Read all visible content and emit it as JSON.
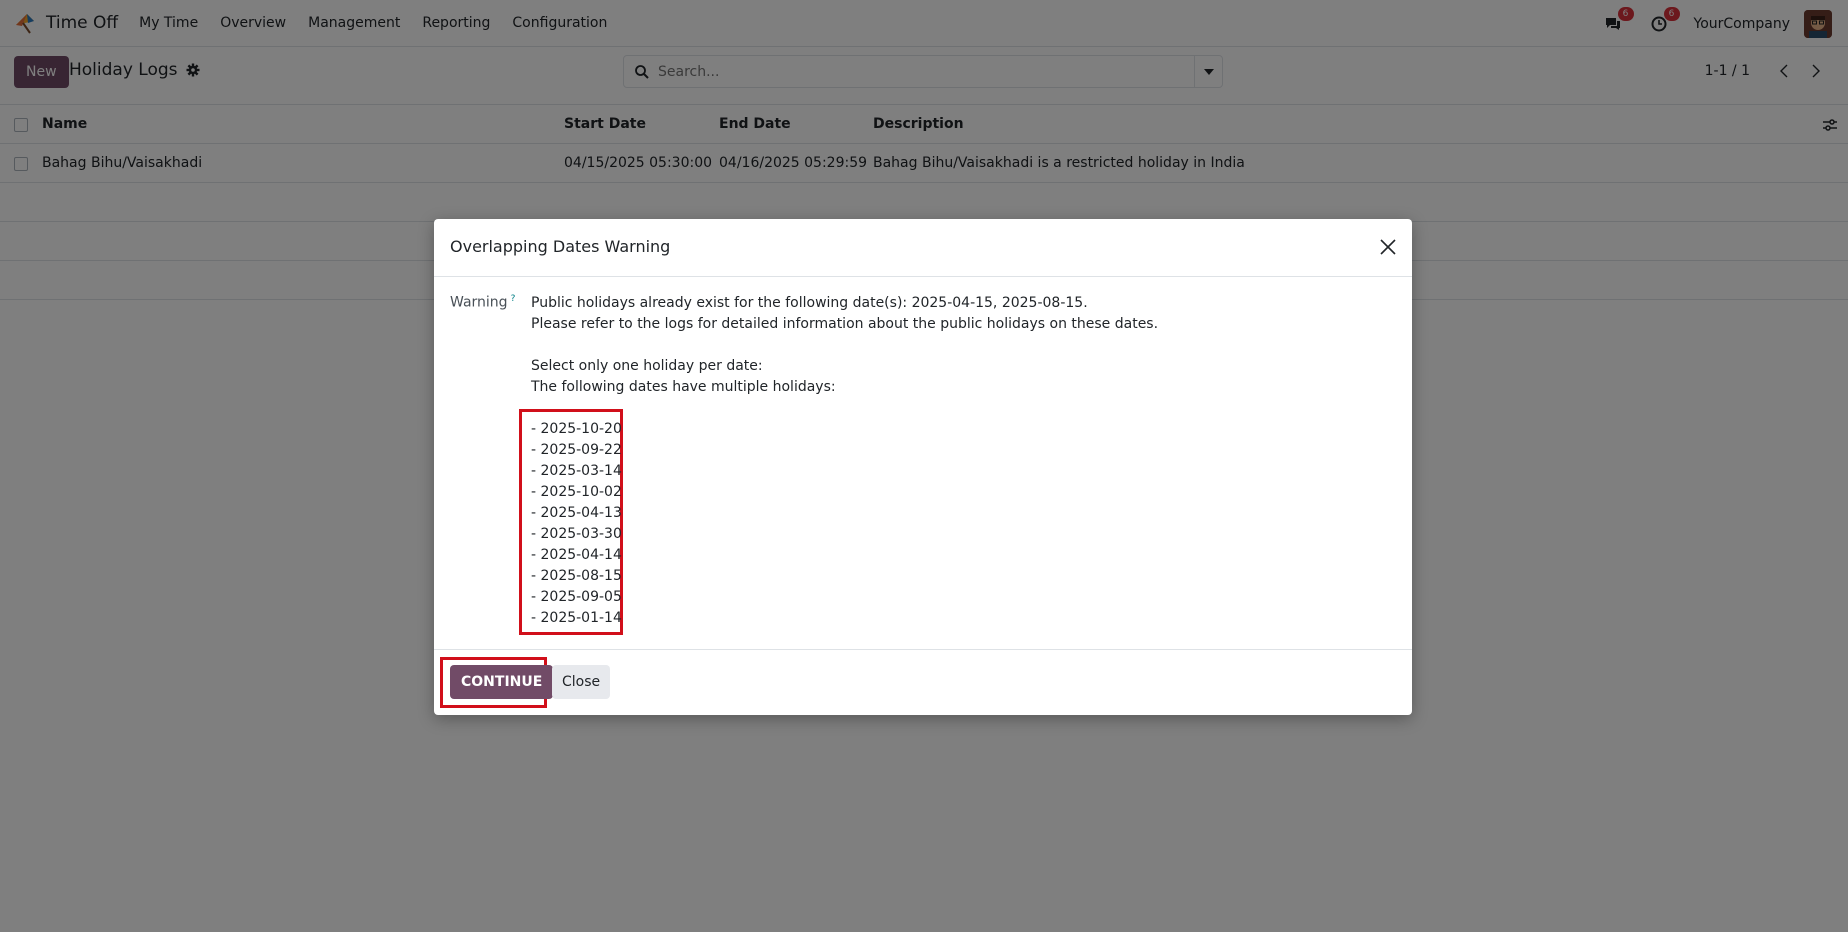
{
  "navbar": {
    "app_name": "Time Off",
    "menu": [
      "My Time",
      "Overview",
      "Management",
      "Reporting",
      "Configuration"
    ],
    "messages_badge": "6",
    "activities_badge": "6",
    "company": "YourCompany"
  },
  "control_panel": {
    "new_label": "New",
    "title": "Holiday Logs",
    "search_placeholder": "Search...",
    "pager": "1-1 / 1"
  },
  "table": {
    "columns": [
      "Name",
      "Start Date",
      "End Date",
      "Description"
    ],
    "rows": [
      {
        "name": "Bahag Bihu/Vaisakhadi",
        "start_date": "04/15/2025 05:30:00",
        "end_date": "04/16/2025 05:29:59",
        "description": "Bahag Bihu/Vaisakhadi is a restricted holiday in India"
      }
    ]
  },
  "modal": {
    "title": "Overlapping Dates Warning",
    "field_label": "Warning",
    "help_mark": "?",
    "lines": [
      "Public holidays already exist for the following date(s): 2025-04-15, 2025-08-15.",
      "Please refer to the logs for detailed information about the public holidays on these dates.",
      "",
      "Select only one holiday per date:",
      "The following dates have multiple holidays:"
    ],
    "dates": [
      "- 2025-10-20",
      "- 2025-09-22",
      "- 2025-03-14",
      "- 2025-10-02",
      "- 2025-04-13",
      "- 2025-03-30",
      "- 2025-04-14",
      "- 2025-08-15",
      "- 2025-09-05",
      "- 2025-01-14"
    ],
    "continue_label": "CONTINUE",
    "close_label": "Close"
  },
  "colors": {
    "brand": "#714b67",
    "highlight": "#d10f1a"
  }
}
